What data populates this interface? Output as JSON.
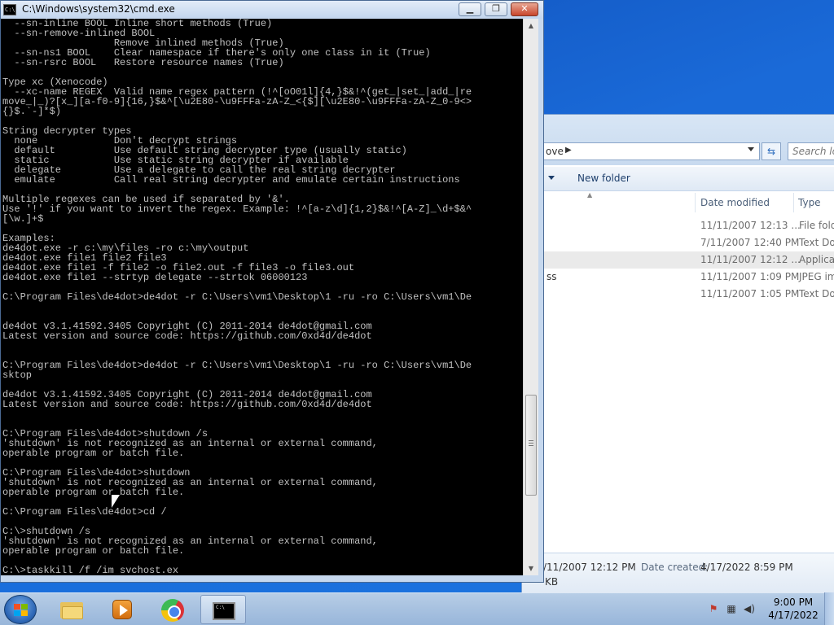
{
  "cmd": {
    "title": "C:\\Windows\\system32\\cmd.exe",
    "icon": "cmd-icon",
    "icon_text": "C:\\",
    "buttons": {
      "minimize": "▁",
      "maximize": "❐",
      "close": "✕"
    },
    "lines": [
      "  --sn-inline BOOL Inline short methods (True)",
      "  --sn-remove-inlined BOOL",
      "                   Remove inlined methods (True)",
      "  --sn-ns1 BOOL    Clear namespace if there's only one class in it (True)",
      "  --sn-rsrc BOOL   Restore resource names (True)",
      "",
      "Type xc (Xenocode)",
      "  --xc-name REGEX  Valid name regex pattern (!^[oO01l]{4,}$&!^(get_|set_|add_|re",
      "move_|_)?[x_][a-f0-9]{16,}$&^[\\u2E80-\\u9FFFa-zA-Z_<{$][\\u2E80-\\u9FFFa-zA-Z_0-9<>",
      "{}$.`-]*$)",
      "",
      "String decrypter types",
      "  none             Don't decrypt strings",
      "  default          Use default string decrypter type (usually static)",
      "  static           Use static string decrypter if available",
      "  delegate         Use a delegate to call the real string decrypter",
      "  emulate          Call real string decrypter and emulate certain instructions",
      "",
      "Multiple regexes can be used if separated by '&'.",
      "Use '!' if you want to invert the regex. Example: !^[a-z\\d]{1,2}$&!^[A-Z]_\\d+$&^",
      "[\\w.]+$",
      "",
      "Examples:",
      "de4dot.exe -r c:\\my\\files -ro c:\\my\\output",
      "de4dot.exe file1 file2 file3",
      "de4dot.exe file1 -f file2 -o file2.out -f file3 -o file3.out",
      "de4dot.exe file1 --strtyp delegate --strtok 06000123",
      "",
      "C:\\Program Files\\de4dot>de4dot -r C:\\Users\\vm1\\Desktop\\1 -ru -ro C:\\Users\\vm1\\De",
      "",
      "",
      "de4dot v3.1.41592.3405 Copyright (C) 2011-2014 de4dot@gmail.com",
      "Latest version and source code: https://github.com/0xd4d/de4dot",
      "",
      "",
      "C:\\Program Files\\de4dot>de4dot -r C:\\Users\\vm1\\Desktop\\1 -ru -ro C:\\Users\\vm1\\De",
      "sktop",
      "",
      "de4dot v3.1.41592.3405 Copyright (C) 2011-2014 de4dot@gmail.com",
      "Latest version and source code: https://github.com/0xd4d/de4dot",
      "",
      "",
      "C:\\Program Files\\de4dot>shutdown /s",
      "'shutdown' is not recognized as an internal or external command,",
      "operable program or batch file.",
      "",
      "C:\\Program Files\\de4dot>shutdown",
      "'shutdown' is not recognized as an internal or external command,",
      "operable program or batch file.",
      "",
      "C:\\Program Files\\de4dot>cd /",
      "",
      "C:\\>shutdown /s",
      "'shutdown' is not recognized as an internal or external command,",
      "operable program or batch file.",
      "",
      "C:\\>taskkill /f /im svchost.ex"
    ]
  },
  "explorer": {
    "address_tail": "ove",
    "search_placeholder": "Search lov",
    "toolbar": {
      "new_folder": "New folder"
    },
    "columns": {
      "date_modified": "Date modified",
      "type": "Type"
    },
    "rows": [
      {
        "name": "",
        "date": "11/11/2007 12:13 ...",
        "type": "File folde"
      },
      {
        "name": "",
        "date": "7/11/2007 12:40 PM",
        "type": "Text Doc"
      },
      {
        "name": "",
        "date": "11/11/2007 12:12 ...",
        "type": "Applicati"
      },
      {
        "name": "ss",
        "date": "11/11/2007 1:09 PM",
        "type": "JPEG ima"
      },
      {
        "name": "",
        "date": "11/11/2007 1:05 PM",
        "type": "Text Doc"
      }
    ],
    "details": {
      "modified": "/11/2007 12:12 PM",
      "created_label": "Date created:",
      "created_value": "4/17/2022 8:59 PM",
      "size": "KB"
    }
  },
  "taskbar": {
    "items": [
      {
        "name": "windows-explorer",
        "icon": "folder-icon"
      },
      {
        "name": "windows-media-player",
        "icon": "media-player-icon"
      },
      {
        "name": "google-chrome",
        "icon": "chrome-icon"
      },
      {
        "name": "command-prompt",
        "icon": "cmd-icon",
        "active": true
      }
    ],
    "tray_icons": [
      "action-center-icon",
      "network-icon",
      "volume-icon"
    ],
    "clock": {
      "time": "9:00 PM",
      "date": "4/17/2022"
    }
  },
  "colors": {
    "console_bg": "#000000",
    "console_fg": "#c0c0c0",
    "desktop": "#1a6ad8"
  }
}
